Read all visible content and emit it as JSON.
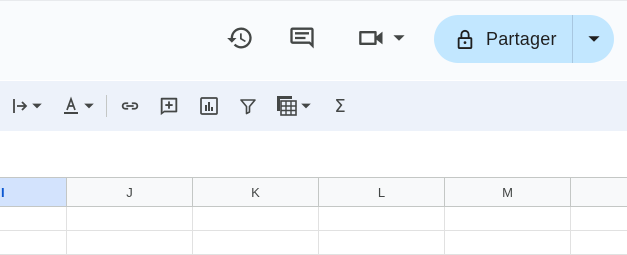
{
  "header": {
    "share_label": "Partager"
  },
  "icons": {
    "history": "history-icon",
    "comments": "comment-icon",
    "meet": "video-camera-icon",
    "lock": "lock-icon"
  },
  "toolbar": {
    "items": [
      "text-rotation-icon",
      "text-color-icon",
      "link-icon",
      "add-comment-icon",
      "insert-chart-icon",
      "filter-icon",
      "table-view-icon",
      "functions-icon"
    ],
    "sigma": "Σ"
  },
  "grid": {
    "columns": [
      "I",
      "J",
      "K",
      "L",
      "M"
    ]
  },
  "colors": {
    "share_bg": "#c2e7ff",
    "toolbar_bg": "#edf2fa",
    "selected_header_bg": "#d3e3fd",
    "selected_header_text": "#0b57d0"
  }
}
